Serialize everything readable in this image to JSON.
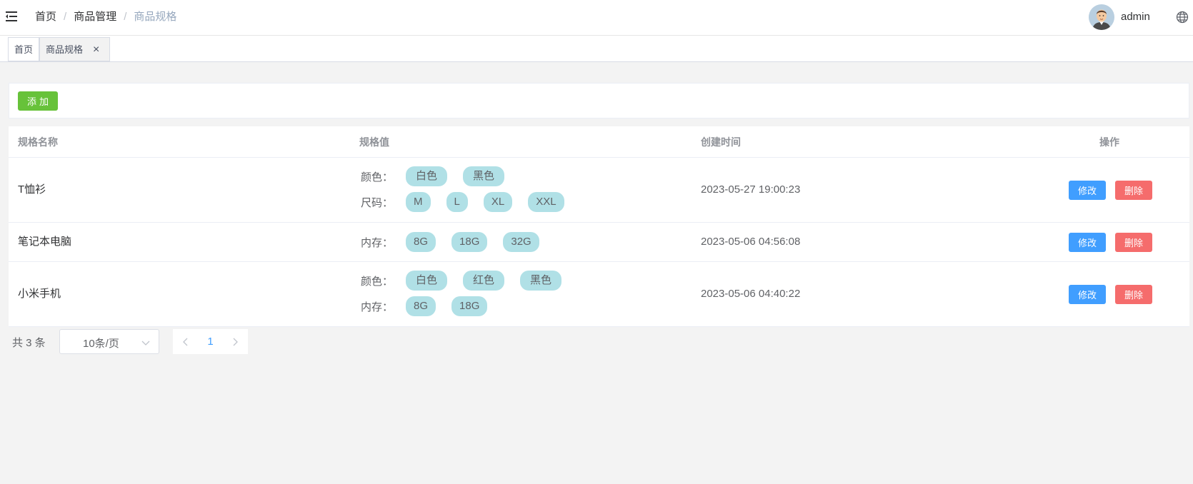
{
  "header": {
    "breadcrumb": [
      "首页",
      "商品管理",
      "商品规格"
    ],
    "separator": "/",
    "username": "admin"
  },
  "tags_view": {
    "tabs": [
      {
        "label": "首页"
      },
      {
        "label": "商品规格",
        "close": "×"
      }
    ]
  },
  "toolbar": {
    "add_label": "添加"
  },
  "table": {
    "headers": [
      "规格名称",
      "规格值",
      "创建时间",
      "操作"
    ],
    "rows": [
      {
        "name": "T恤衫",
        "specs": [
          {
            "label": "颜色：",
            "values": [
              "白色",
              "黑色"
            ]
          },
          {
            "label": "尺码：",
            "values": [
              "M",
              "L",
              "XL",
              "XXL"
            ]
          }
        ],
        "created": "2023-05-27 19:00:23",
        "edit_label": "修改",
        "delete_label": "删除"
      },
      {
        "name": "笔记本电脑",
        "specs": [
          {
            "label": "内存：",
            "values": [
              "8G",
              "18G",
              "32G"
            ]
          }
        ],
        "created": "2023-05-06 04:56:08",
        "edit_label": "修改",
        "delete_label": "删除"
      },
      {
        "name": "小米手机",
        "specs": [
          {
            "label": "颜色：",
            "values": [
              "白色",
              "红色",
              "黑色"
            ]
          },
          {
            "label": "内存：",
            "values": [
              "8G",
              "18G"
            ]
          }
        ],
        "created": "2023-05-06 04:40:22",
        "edit_label": "修改",
        "delete_label": "删除"
      }
    ]
  },
  "pagination": {
    "total": "共 3 条",
    "page_size": "10条/页",
    "current_page": "1"
  },
  "colors": {
    "add_button": "#67c23a",
    "edit_button": "#409eff",
    "delete_button": "#f56c6c",
    "chip": "#b0e0e6",
    "breadcrumb_current": "#97a8be"
  }
}
